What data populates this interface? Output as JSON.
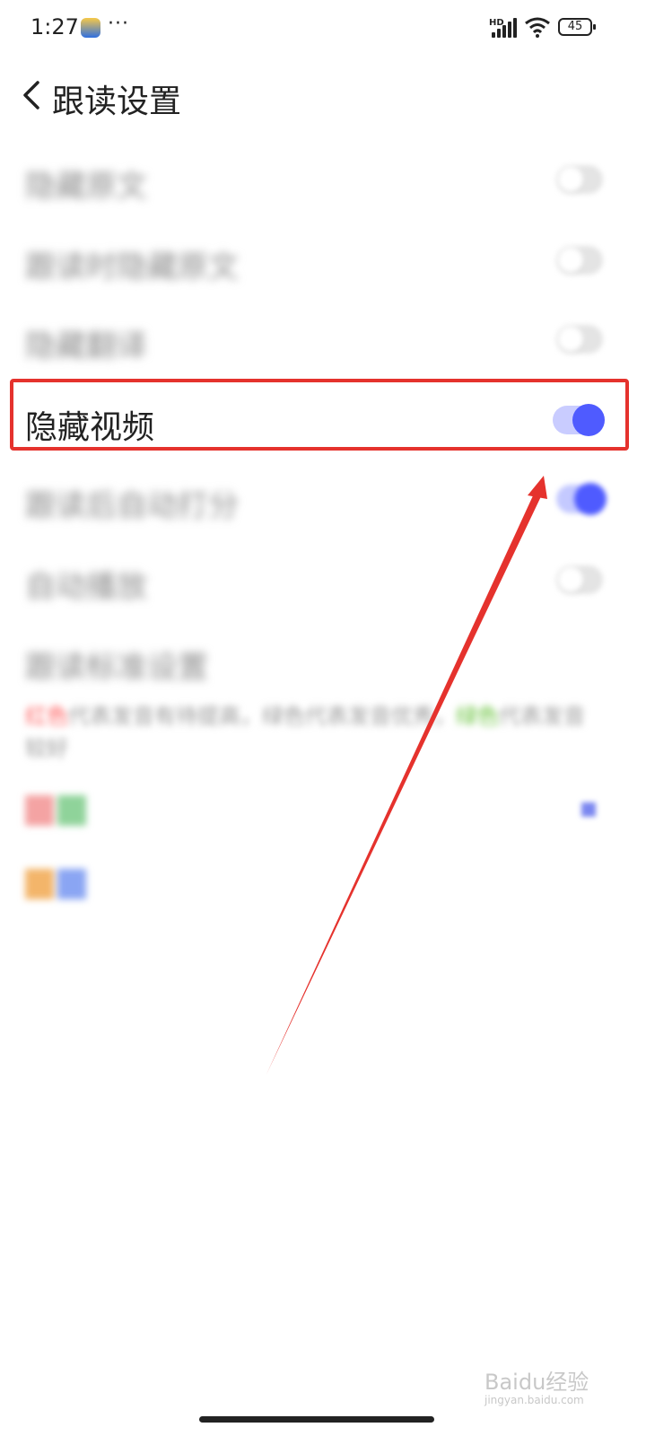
{
  "status_bar": {
    "time": "1:27",
    "more": "···",
    "network": "HD",
    "battery": "45"
  },
  "header": {
    "title": "跟读设置"
  },
  "settings": [
    {
      "label": "隐藏原文",
      "state": "off"
    },
    {
      "label": "跟读时隐藏原文",
      "state": "off"
    },
    {
      "label": "隐藏翻译",
      "state": "off"
    },
    {
      "label": "隐藏视频",
      "state": "on"
    },
    {
      "label": "跟读后自动打分",
      "state": "on"
    },
    {
      "label": "自动播放",
      "state": "off"
    }
  ],
  "score_setting": {
    "title": "跟读标准设置",
    "description_red": "红色",
    "description_mid": "代表发音有待提高，绿色代表发音优秀，",
    "description_green": "绿色",
    "description_end": "代表发音较好"
  },
  "colors": {
    "accent": "#4f5bff",
    "toggle_track_on": "#c4c9ff",
    "toggle_track_off": "#e4e4e4",
    "highlight": "#e5322d"
  },
  "watermark": {
    "brand": "Baidu经验",
    "url": "jingyan.baidu.com"
  }
}
